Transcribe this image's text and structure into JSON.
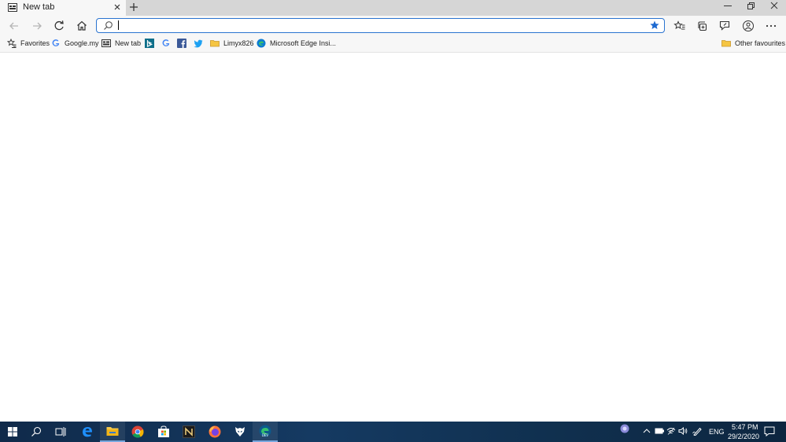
{
  "tab": {
    "title": "New tab"
  },
  "addressbar": {
    "value": "",
    "placeholder": ""
  },
  "favorites_bar": {
    "items": [
      {
        "label": "Favorites",
        "icon": "favorites-star-icon"
      },
      {
        "label": "Google.my",
        "icon": "google-icon"
      },
      {
        "label": "New tab",
        "icon": "new-tab-page-icon"
      },
      {
        "label": "",
        "icon": "bing-icon"
      },
      {
        "label": "",
        "icon": "google-icon"
      },
      {
        "label": "",
        "icon": "facebook-icon"
      },
      {
        "label": "",
        "icon": "twitter-icon"
      },
      {
        "label": "Limyx826",
        "icon": "folder-icon"
      },
      {
        "label": "Microsoft Edge Insi...",
        "icon": "edge-icon"
      }
    ],
    "other": {
      "label": "Other favourites",
      "icon": "folder-icon"
    }
  },
  "taskbar": {
    "apps": [
      "start-icon",
      "search-icon",
      "task-view-icon",
      "edge-legacy-icon",
      "file-explorer-icon",
      "chrome-icon",
      "store-icon",
      "notion-icon",
      "firefox-icon",
      "app-icon",
      "edge-dev-icon"
    ],
    "language": "ENG",
    "time": "5:47 PM",
    "date": "29/2/2020"
  },
  "colors": {
    "accent": "#2b74d0",
    "taskbar": "#153a62",
    "tabstrip": "#d6d6d6",
    "toolbar": "#f7f7f7"
  }
}
